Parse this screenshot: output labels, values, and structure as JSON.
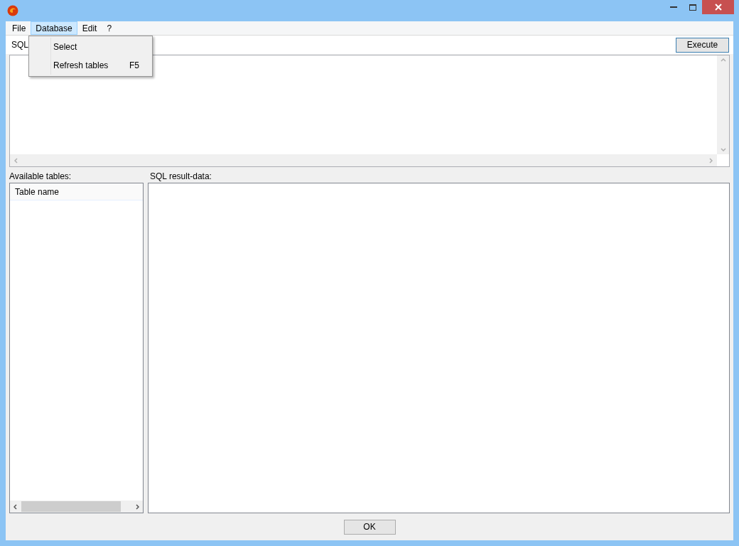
{
  "menu_bar": [
    {
      "label": "File",
      "selected": false
    },
    {
      "label": "Database",
      "selected": true
    },
    {
      "label": "Edit",
      "selected": false
    },
    {
      "label": "?",
      "selected": false
    }
  ],
  "dropdown": [
    {
      "label": "Select"
    },
    {
      "label": "Refresh tables",
      "shortcut": "F5"
    }
  ],
  "sql_label": "SQL",
  "execute_button": "Execute",
  "tables_label": "Available tables:",
  "tables_columns": [
    "Table name"
  ],
  "result_label": "SQL result-data:",
  "ok_button": "OK"
}
